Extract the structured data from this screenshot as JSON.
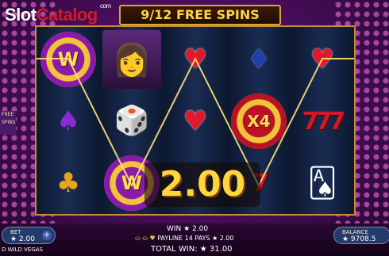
{
  "logo": {
    "part_a": "Slot",
    "part_b": "Catalog",
    "suffix": "com"
  },
  "banner": {
    "text": "9/12  FREE SPINS"
  },
  "reels": {
    "r1": [
      "W",
      "♠",
      "♣"
    ],
    "r2": [
      "👩",
      "🎲",
      "W"
    ],
    "r3": [
      "♥",
      "♥",
      ""
    ],
    "r4": [
      "♦",
      "X4",
      "7"
    ],
    "r5": [
      "♥",
      "777",
      "🂡"
    ]
  },
  "win_amount": "2.00",
  "side_tab": "FREE SPINS",
  "bottom": {
    "bet_label": "BET",
    "bet_value": "★ 2.00",
    "balance_label": "BALANCE",
    "balance_value": "★ 9708.5",
    "game_name": "D WILD VEGAS",
    "win_text": "WIN ★ 2.00",
    "payline_icons": "⛀ ⛀ ♥",
    "payline_text": "PAYLINE 14 PAYS ★ 2.00",
    "total_text": "TOTAL WIN: ★ 31.00"
  },
  "colors": {
    "accent": "#ffd63b",
    "frame": "#c98b2e",
    "heart": "#e0192d"
  }
}
